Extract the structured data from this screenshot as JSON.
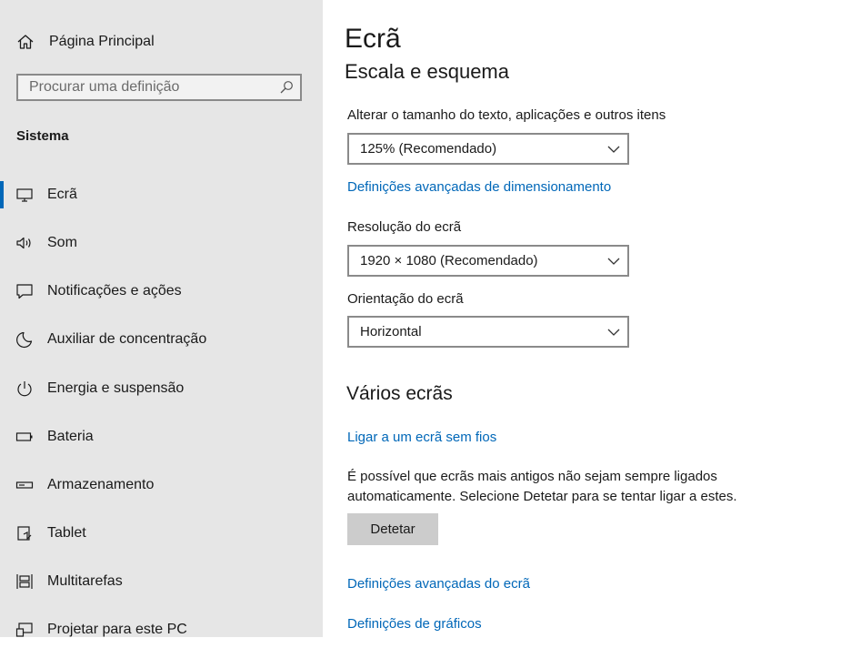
{
  "sidebar": {
    "home_label": "Página Principal",
    "search_placeholder": "Procurar uma definição",
    "section_title": "Sistema",
    "items": [
      {
        "label": "Ecrã",
        "icon": "monitor-icon",
        "selected": true
      },
      {
        "label": "Som",
        "icon": "speaker-icon"
      },
      {
        "label": "Notificações e ações",
        "icon": "notification-icon"
      },
      {
        "label": "Auxiliar de concentração",
        "icon": "moon-icon"
      },
      {
        "label": "Energia e suspensão",
        "icon": "power-icon"
      },
      {
        "label": "Bateria",
        "icon": "battery-icon"
      },
      {
        "label": "Armazenamento",
        "icon": "storage-icon"
      },
      {
        "label": "Tablet",
        "icon": "tablet-icon"
      },
      {
        "label": "Multitarefas",
        "icon": "multitasking-icon"
      },
      {
        "label": "Projetar para este PC",
        "icon": "project-icon"
      }
    ]
  },
  "main": {
    "title": "Ecrã",
    "scale_section": "Escala e esquema",
    "text_size_label": "Alterar o tamanho do texto, aplicações e outros itens",
    "text_size_value": "125% (Recomendado)",
    "advanced_scaling_link": "Definições avançadas de dimensionamento",
    "resolution_label": "Resolução do ecrã",
    "resolution_value": "1920 × 1080 (Recomendado)",
    "orientation_label": "Orientação do ecrã",
    "orientation_value": "Horizontal",
    "multi_section": "Vários ecrãs",
    "wireless_link": "Ligar a um ecrã sem fios",
    "detect_info": "É possível que ecrãs mais antigos não sejam sempre ligados automaticamente. Selecione Detetar para se tentar ligar a estes.",
    "detect_button": "Detetar",
    "advanced_display_link": "Definições avançadas do ecrã",
    "graphics_link": "Definições de gráficos"
  },
  "colors": {
    "accent": "#0067b8",
    "sidebar_bg": "#e6e6e6",
    "button_bg": "#cccccc"
  }
}
